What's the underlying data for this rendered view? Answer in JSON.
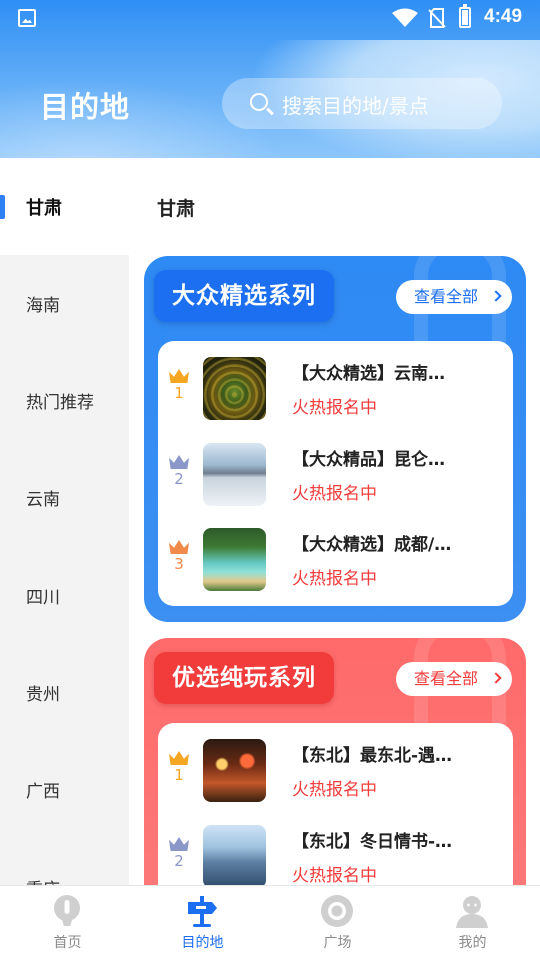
{
  "status_bar": {
    "time": "4:49"
  },
  "header": {
    "title": "目的地",
    "search_placeholder": "搜索目的地/景点"
  },
  "sidebar": {
    "items": [
      {
        "label": "甘肃",
        "active": true
      },
      {
        "label": "海南"
      },
      {
        "label": "热门推荐"
      },
      {
        "label": "云南"
      },
      {
        "label": "四川"
      },
      {
        "label": "贵州"
      },
      {
        "label": "广西"
      },
      {
        "label": "重庆"
      }
    ]
  },
  "main": {
    "section_title": "甘肃",
    "cards": [
      {
        "title": "大众精选系列",
        "view_all": "查看全部",
        "color": "#2e8af4",
        "items": [
          {
            "rank": "1",
            "name": "【大众精选】云南…",
            "status": "火热报名中",
            "thumb": "peacock-photo"
          },
          {
            "rank": "2",
            "name": "【大众精品】昆仑…",
            "status": "火热报名中",
            "thumb": "salt-lake-photo"
          },
          {
            "rank": "3",
            "name": "【大众精选】成都/…",
            "status": "火热报名中",
            "thumb": "terraced-pools-photo"
          }
        ]
      },
      {
        "title": "优选纯玩系列",
        "view_all": "查看全部",
        "color": "#f23b3b",
        "items": [
          {
            "rank": "1",
            "name": "【东北】最东北-遇…",
            "status": "火热报名中",
            "thumb": "night-market-photo"
          },
          {
            "rank": "2",
            "name": "【东北】冬日情书-…",
            "status": "火热报名中",
            "thumb": "snow-forest-photo"
          }
        ]
      }
    ]
  },
  "bottom_nav": {
    "tabs": [
      {
        "label": "首页",
        "icon": "balloon-icon"
      },
      {
        "label": "目的地",
        "icon": "signpost-icon",
        "active": true
      },
      {
        "label": "广场",
        "icon": "ring-icon"
      },
      {
        "label": "我的",
        "icon": "user-icon"
      }
    ]
  }
}
